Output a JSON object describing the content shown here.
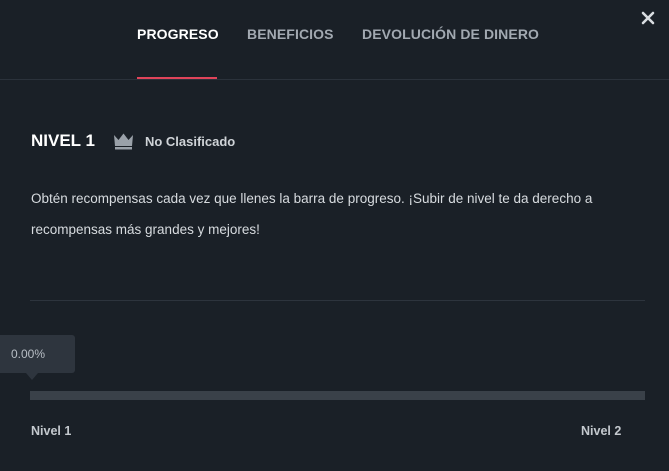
{
  "tabs": [
    {
      "label": "PROGRESO",
      "active": true
    },
    {
      "label": "BENEFICIOS",
      "active": false
    },
    {
      "label": "DEVOLUCIÓN DE DINERO",
      "active": false
    }
  ],
  "close_icon": "close-icon",
  "level": {
    "title": "NIVEL 1",
    "rank_icon": "crown-icon",
    "rank": "No Clasificado"
  },
  "description": "Obtén recompensas cada vez que llenes la barra de progreso. ¡Subir de nivel te da derecho a recompensas más grandes y mejores!",
  "progress": {
    "label": "0.00%",
    "fraction": 0.0,
    "start_label": "Nivel 1",
    "end_label": "Nivel 2"
  },
  "colors": {
    "background": "#1a2027",
    "accent": "#e0445a",
    "track": "#3a4149",
    "tooltip": "#2e353e"
  }
}
